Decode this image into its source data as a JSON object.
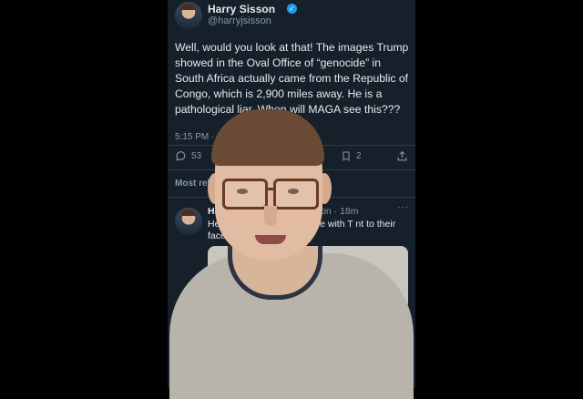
{
  "tweet": {
    "author_name": "Harry Sisson",
    "author_handle": "@harryjsisson",
    "text": "Well, would you look at that! The images Trump showed in the Oval Office of “genocide” in South Africa actually came from the Republic of Congo, which is 2,900 miles away. He is a pathological liar. When will MAGA see this???",
    "timestamp": "5:15 PM · 5/",
    "replies_count": "53",
    "bookmarks_count": "2"
  },
  "most_relevant_label": "Most rele",
  "reply": {
    "author_name": "Harr",
    "author_handle": "sisson · 18m",
    "more_label": "···",
    "text": "Here  MAGA is perfectly fine with T  nt to their faces."
  },
  "colors": {
    "background": "#15202b",
    "verified_badge": "#1d9bf0",
    "text_primary": "#e7e9ea",
    "text_secondary": "#8b98a5"
  }
}
